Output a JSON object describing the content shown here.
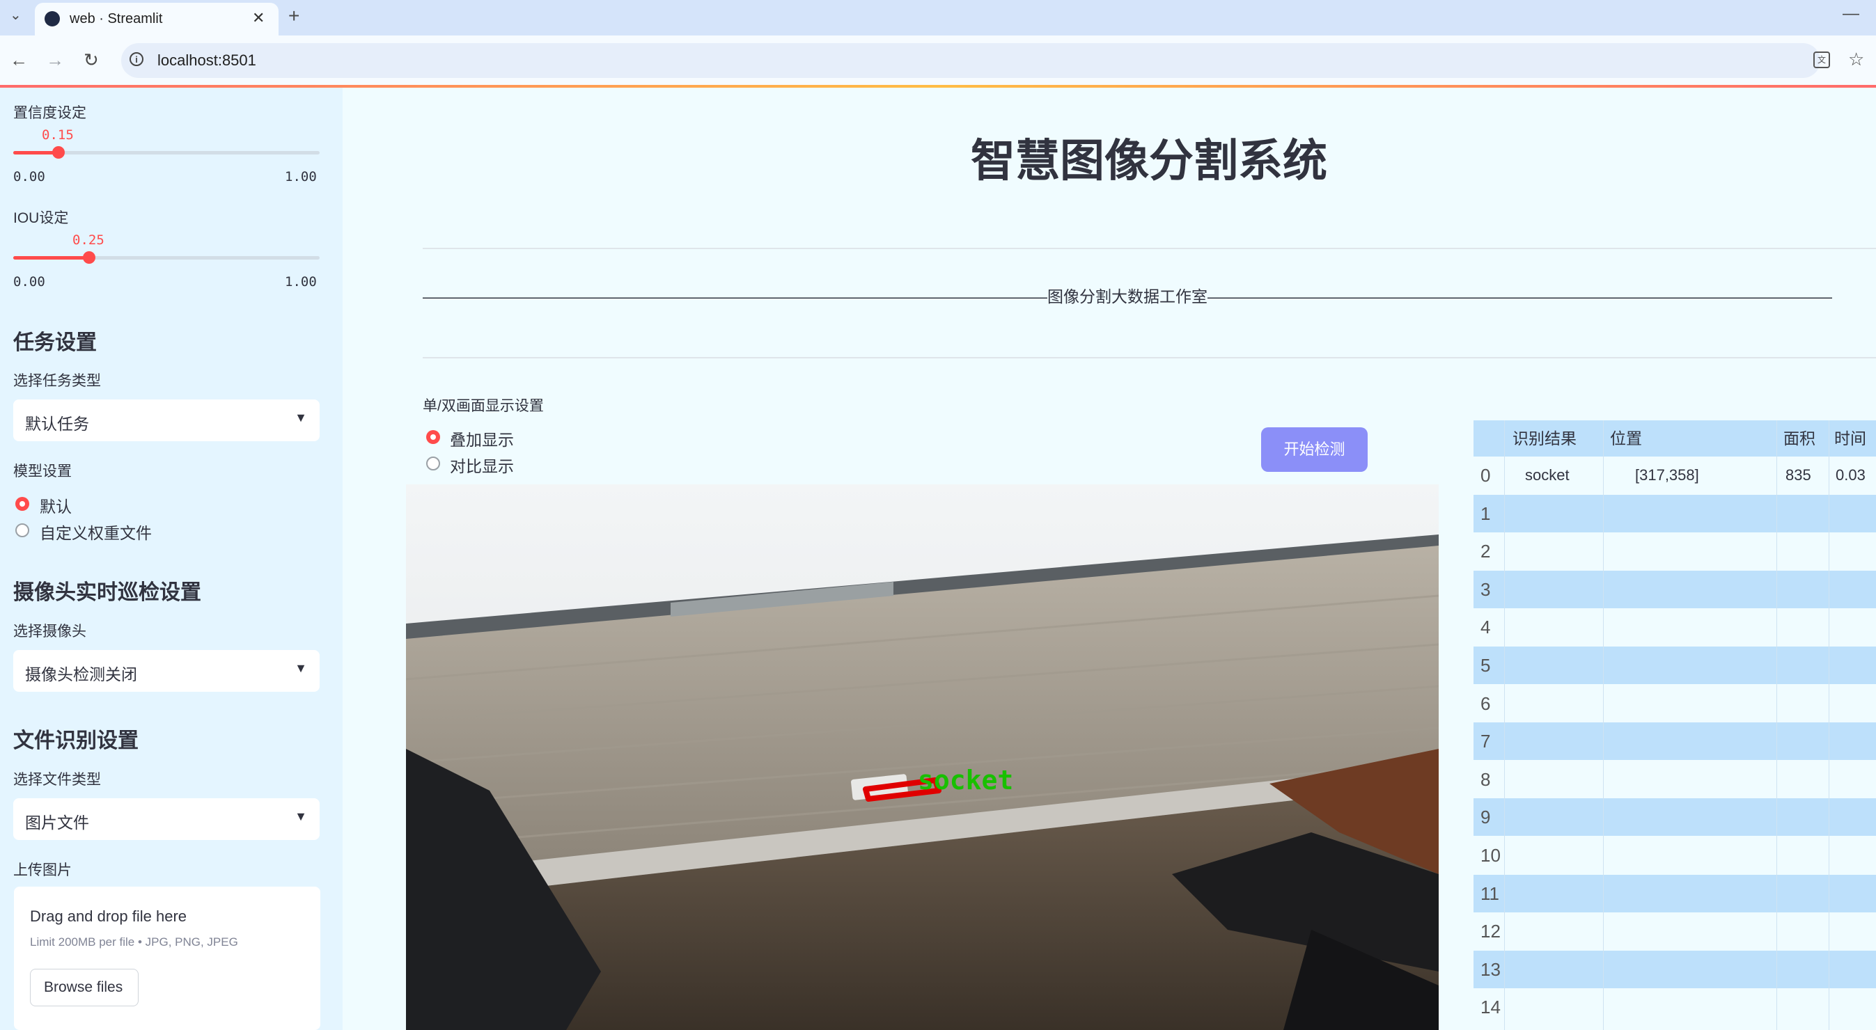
{
  "browser": {
    "tab_title": "web · Streamlit",
    "url": "localhost:8501"
  },
  "sidebar": {
    "confidence": {
      "label": "置信度设定",
      "value_text": "0.15",
      "value": 0.15,
      "min": "0.00",
      "max": "1.00"
    },
    "iou": {
      "label": "IOU设定",
      "value_text": "0.25",
      "value": 0.25,
      "min": "0.00",
      "max": "1.00"
    },
    "task_header": "任务设置",
    "task_type_label": "选择任务类型",
    "task_type_value": "默认任务",
    "model_label": "模型设置",
    "model_options": [
      "默认",
      "自定义权重文件"
    ],
    "model_selected": 0,
    "camera_header": "摄像头实时巡检设置",
    "camera_label": "选择摄像头",
    "camera_value": "摄像头检测关闭",
    "file_header": "文件识别设置",
    "file_type_label": "选择文件类型",
    "file_type_value": "图片文件",
    "upload_label": "上传图片",
    "upload_drag": "Drag and drop file here",
    "upload_limit": "Limit 200MB per file • JPG, PNG, JPEG",
    "browse_label": "Browse files"
  },
  "main": {
    "title": "智慧图像分割系统",
    "divider_text": "———————————————————————————————————————图像分割大数据工作室———————————————————————————————————————",
    "display_label": "单/双画面显示设置",
    "display_options": [
      "叠加显示",
      "对比显示"
    ],
    "display_selected": 0,
    "start_button": "开始检测",
    "detection_label": "socket"
  },
  "table": {
    "headers": [
      "识别结果",
      "位置",
      "面积",
      "时间"
    ],
    "rows": [
      {
        "index": "0",
        "result": "socket",
        "position": "[317,358]",
        "area": "835",
        "time": "0.03"
      },
      {
        "index": "1",
        "result": "",
        "position": "",
        "area": "",
        "time": ""
      },
      {
        "index": "2",
        "result": "",
        "position": "",
        "area": "",
        "time": ""
      },
      {
        "index": "3",
        "result": "",
        "position": "",
        "area": "",
        "time": ""
      },
      {
        "index": "4",
        "result": "",
        "position": "",
        "area": "",
        "time": ""
      },
      {
        "index": "5",
        "result": "",
        "position": "",
        "area": "",
        "time": ""
      },
      {
        "index": "6",
        "result": "",
        "position": "",
        "area": "",
        "time": ""
      },
      {
        "index": "7",
        "result": "",
        "position": "",
        "area": "",
        "time": ""
      },
      {
        "index": "8",
        "result": "",
        "position": "",
        "area": "",
        "time": ""
      },
      {
        "index": "9",
        "result": "",
        "position": "",
        "area": "",
        "time": ""
      },
      {
        "index": "10",
        "result": "",
        "position": "",
        "area": "",
        "time": ""
      },
      {
        "index": "11",
        "result": "",
        "position": "",
        "area": "",
        "time": ""
      },
      {
        "index": "12",
        "result": "",
        "position": "",
        "area": "",
        "time": ""
      },
      {
        "index": "13",
        "result": "",
        "position": "",
        "area": "",
        "time": ""
      },
      {
        "index": "14",
        "result": "",
        "position": "",
        "area": "",
        "time": ""
      }
    ]
  },
  "colors": {
    "accent": "#ff4b4b",
    "button": "#8b8ff8",
    "sidebar_bg": "#e4f5ff",
    "table_stripe": "#bde0fb"
  }
}
